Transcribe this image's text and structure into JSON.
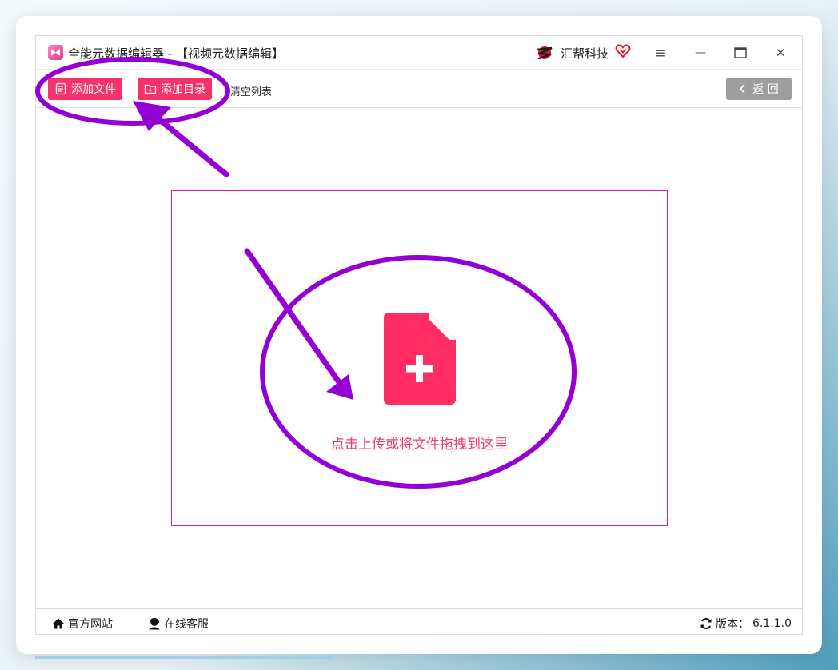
{
  "window": {
    "title": "全能元数据编辑器 - 【视频元数据编辑】",
    "brand_name": "汇帮科技",
    "controls": {
      "menu": "≡",
      "minimize": "—",
      "maximize": "▭",
      "close": "✕"
    }
  },
  "toolbar": {
    "add_file_label": "添加文件",
    "add_folder_label": "添加目录",
    "clear_list_label": "清空列表",
    "back_label": "返 回"
  },
  "dropzone": {
    "hint": "点击上传或将文件拖拽到这里"
  },
  "statusbar": {
    "website_label": "官方网站",
    "support_label": "在线客服",
    "version_label": "版本：",
    "version_value": "6.1.1.0"
  },
  "colors": {
    "accent": "#f5336a",
    "annotation": "#9400d3",
    "dropzone_border": "#e0208a",
    "back_button": "#9e9e9e"
  },
  "icons": {
    "app": "app-logo-icon",
    "brand": "brand-logo-icon",
    "vip": "vip-heart-icon",
    "add_file": "document-icon",
    "add_folder": "folder-add-icon",
    "back": "chevron-left-icon",
    "upload": "file-add-icon",
    "website": "home-icon",
    "support": "headset-icon",
    "version": "refresh-icon"
  }
}
